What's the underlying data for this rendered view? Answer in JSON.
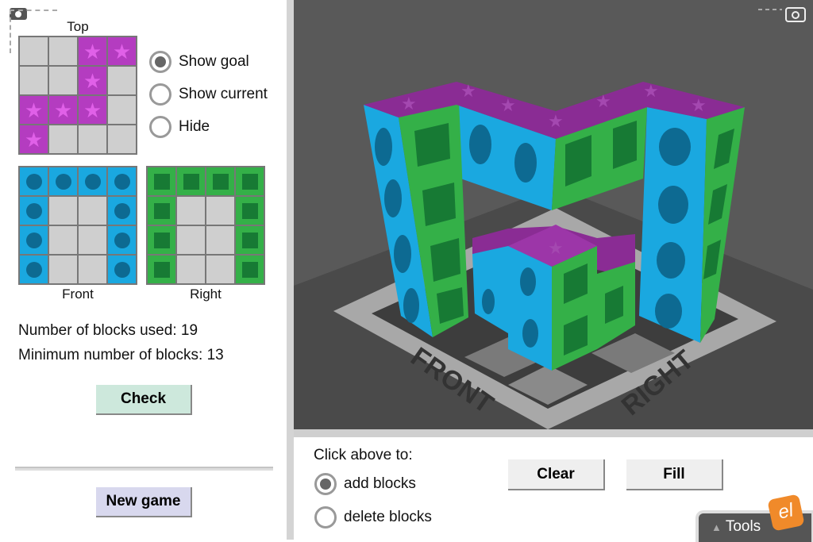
{
  "goal_panel": {
    "top_label": "Top",
    "front_label": "Front",
    "right_label": "Right",
    "top_grid": [
      [
        "e",
        "e",
        "p",
        "p"
      ],
      [
        "e",
        "e",
        "p",
        "e"
      ],
      [
        "p",
        "p",
        "p",
        "e"
      ],
      [
        "p",
        "e",
        "e",
        "e"
      ]
    ],
    "front_grid": [
      [
        "b",
        "b",
        "b",
        "b"
      ],
      [
        "b",
        "e",
        "e",
        "b"
      ],
      [
        "b",
        "e",
        "e",
        "b"
      ],
      [
        "b",
        "e",
        "e",
        "b"
      ]
    ],
    "right_grid": [
      [
        "g",
        "g",
        "g",
        "g"
      ],
      [
        "g",
        "e",
        "e",
        "g"
      ],
      [
        "g",
        "e",
        "e",
        "g"
      ],
      [
        "g",
        "e",
        "e",
        "g"
      ]
    ],
    "view_options": [
      {
        "label": "Show goal",
        "selected": true
      },
      {
        "label": "Show current",
        "selected": false
      },
      {
        "label": "Hide",
        "selected": false
      }
    ]
  },
  "stats": {
    "blocks_used": "Number of blocks used: 19",
    "min_blocks": "Minimum number of blocks: 13"
  },
  "buttons": {
    "check": "Check",
    "new_game": "New game",
    "clear": "Clear",
    "fill": "Fill"
  },
  "mode": {
    "prompt": "Click above to:",
    "options": [
      {
        "label": "add blocks",
        "selected": true
      },
      {
        "label": "delete blocks",
        "selected": false
      }
    ]
  },
  "scene": {
    "front_label": "FRONT",
    "right_label": "RIGHT"
  },
  "tools": {
    "label": "Tools",
    "logo": "el"
  },
  "colors": {
    "purple": "#b43cc0",
    "blue": "#1aa8e0",
    "green": "#34b048",
    "scene_bg": "#595959"
  },
  "icons": [
    "camera-icon",
    "star-icon",
    "circle-icon",
    "square-icon",
    "triangle-up-icon"
  ]
}
